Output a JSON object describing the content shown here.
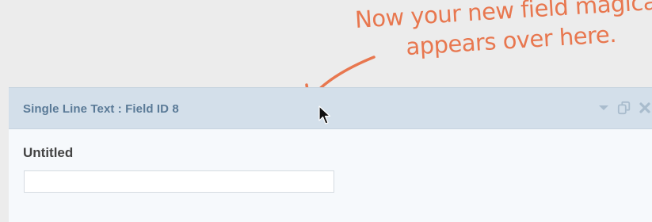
{
  "annotation": {
    "line1": "Now your new field magically",
    "line2": "appears over here."
  },
  "field": {
    "header_title": "Single Line Text : Field ID 8",
    "label": "Untitled",
    "input_value": "",
    "input_placeholder": "",
    "actions": [
      {
        "name": "collapse-icon",
        "glyph": "▾"
      },
      {
        "name": "duplicate-icon",
        "glyph": "⧉"
      },
      {
        "name": "delete-icon",
        "glyph": "✖"
      }
    ]
  },
  "colors": {
    "annotation": "#e8774f",
    "header_bg": "#d3dfea",
    "header_text": "#5a7a97",
    "panel_bg": "#f6f9fc",
    "page_bg": "#ececec"
  }
}
